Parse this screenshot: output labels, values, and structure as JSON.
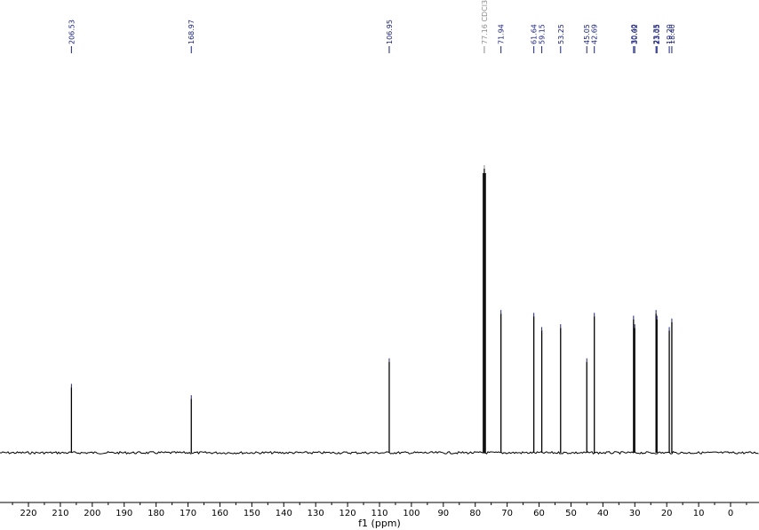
{
  "chart_data": {
    "type": "line",
    "title": "",
    "xlabel": "f1 (ppm)",
    "ylabel": "",
    "xlim": [
      227,
      -8
    ],
    "x_reversed": true,
    "ylim": [
      0,
      1
    ],
    "grid": false,
    "legend": "none",
    "x_ticks": [
      220,
      210,
      200,
      190,
      180,
      170,
      160,
      150,
      140,
      130,
      120,
      110,
      100,
      90,
      80,
      70,
      60,
      50,
      40,
      30,
      20,
      10,
      0
    ],
    "peaks": [
      {
        "shift": 206.53,
        "label": "206.53",
        "height": 0.23
      },
      {
        "shift": 168.97,
        "label": "168.97",
        "height": 0.19
      },
      {
        "shift": 106.95,
        "label": "106.95",
        "height": 0.32
      },
      {
        "shift": 77.16,
        "label": "77.16 CDCl3",
        "height": 1.0,
        "solvent": true
      },
      {
        "shift": 71.94,
        "label": "71.94",
        "height": 0.49
      },
      {
        "shift": 61.64,
        "label": "61.64",
        "height": 0.48
      },
      {
        "shift": 59.15,
        "label": "59.15",
        "height": 0.43
      },
      {
        "shift": 53.25,
        "label": "53.25",
        "height": 0.44
      },
      {
        "shift": 45.05,
        "label": "45.05",
        "height": 0.32
      },
      {
        "shift": 42.69,
        "label": "42.69",
        "height": 0.48
      },
      {
        "shift": 30.4,
        "label": "30.40",
        "height": 0.47
      },
      {
        "shift": 30.02,
        "label": "30.02",
        "height": 0.44
      },
      {
        "shift": 23.35,
        "label": "23.35",
        "height": 0.49
      },
      {
        "shift": 23.05,
        "label": "23.05",
        "height": 0.47
      },
      {
        "shift": 19.2,
        "label": "19.20",
        "height": 0.43
      },
      {
        "shift": 18.4,
        "label": "18.40",
        "height": 0.46
      }
    ]
  },
  "colors": {
    "spectrum": "#000000",
    "peak_label": "#1a237e",
    "solvent_label": "#8c8c8c",
    "axis": "#000000"
  }
}
